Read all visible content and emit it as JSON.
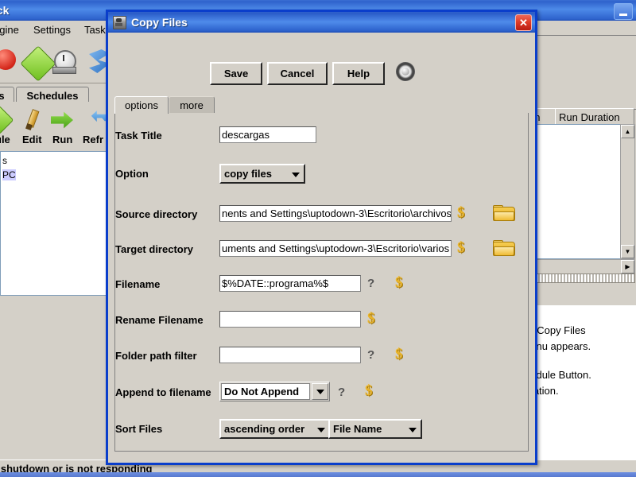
{
  "background": {
    "window_title": "ack",
    "minimize_label": "—",
    "menu": [
      {
        "label": "ngine"
      },
      {
        "label": "Settings"
      },
      {
        "label": "Task"
      }
    ],
    "tabs": [
      {
        "label": "s"
      },
      {
        "label": "Schedules"
      }
    ],
    "toolbar": [
      {
        "label": "ule",
        "icon": "calendar-icon"
      },
      {
        "label": "Edit",
        "icon": "pencil-icon"
      },
      {
        "label": "Run",
        "icon": "green-arrow-icon"
      },
      {
        "label": "Refr",
        "icon": "refresh-icon"
      }
    ],
    "tree": [
      {
        "label": "s",
        "selected": false
      },
      {
        "label": "PC",
        "selected": true
      }
    ],
    "table_headers": [
      "un",
      "Run Duration"
    ],
    "help_lines": [
      "/ Copy Files",
      "nenu appears.",
      "hedule Button.",
      "mation."
    ],
    "status_text": "s shutdown or is not responding"
  },
  "dialog": {
    "title": "Copy Files",
    "title_icon": "app-icon",
    "close_label": "✕",
    "toolbar": {
      "save_label": "Save",
      "cancel_label": "Cancel",
      "help_label": "Help",
      "record_icon": "record-icon"
    },
    "tabs": [
      {
        "label": "options",
        "active": true
      },
      {
        "label": "more",
        "active": false
      }
    ],
    "fields": {
      "task_title": {
        "label": "Task Title",
        "value": "descargas",
        "placeholder": ""
      },
      "option": {
        "label": "Option",
        "value": "copy files"
      },
      "source_directory": {
        "label": "Source directory",
        "value": "nents and Settings\\uptodown-3\\Escritorio\\archivos",
        "placeholder": ""
      },
      "target_directory": {
        "label": "Target directory",
        "value": "uments and Settings\\uptodown-3\\Escritorio\\varios",
        "placeholder": ""
      },
      "filename": {
        "label": "Filename",
        "value": "$%DATE::programa%$",
        "placeholder": "",
        "help_mark": "?"
      },
      "rename_filename": {
        "label": "Rename Filename",
        "value": "",
        "placeholder": ""
      },
      "folder_path_filter": {
        "label": "Folder path filter",
        "value": "",
        "placeholder": "",
        "help_mark": "?"
      },
      "append_to_filename": {
        "label": "Append to filename",
        "value": "Do Not Append",
        "help_mark": "?"
      },
      "sort_files": {
        "label": "Sort Files",
        "order_value": "ascending order",
        "key_value": "File Name"
      }
    },
    "icons": {
      "dollar": "dollar-variable-icon",
      "folder": "folder-browse-icon"
    }
  },
  "colors": {
    "title_blue": "#2f62cc",
    "dialog_border": "#0a3ecb",
    "face": "#d4d0c8",
    "close_red": "#e03c28",
    "dollar_gold": "#e8b32a",
    "selection": "#ccccff"
  }
}
